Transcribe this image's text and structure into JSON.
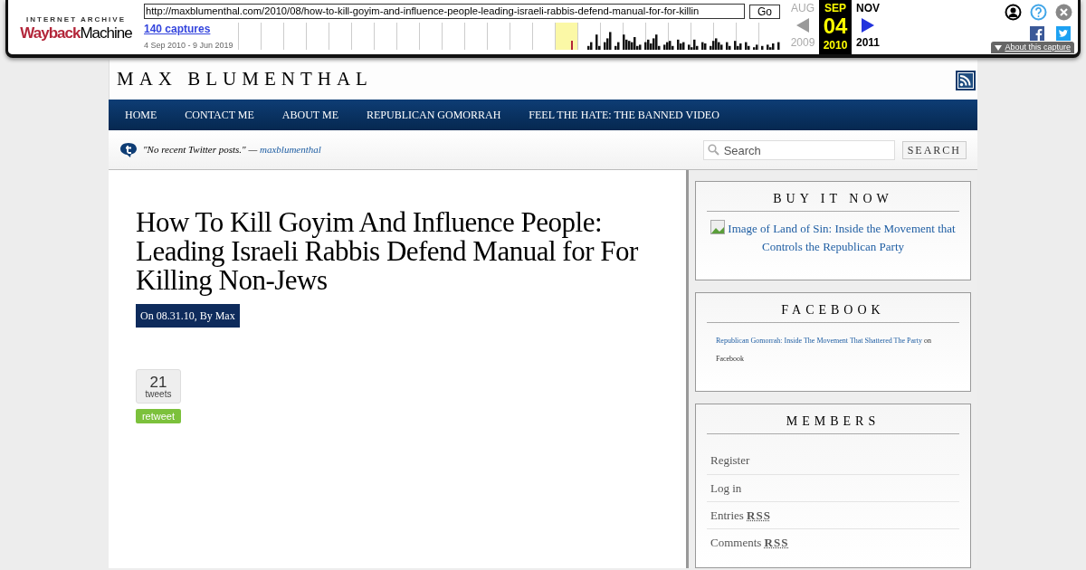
{
  "wayback": {
    "logo_top": "INTERNET ARCHIVE",
    "logo_left": "Wayback",
    "logo_right": "Machine",
    "url": "http://maxblumenthal.com/2010/08/how-to-kill-goyim-and-influence-people-leading-israeli-rabbis-defend-manual-for-for-killin",
    "go": "Go",
    "captures": "140 captures",
    "range": "4 Sep 2010 - 9 Jun 2019",
    "months": [
      {
        "month": "AUG",
        "year": "2009",
        "selected": false
      },
      {
        "month": "SEP",
        "day": "04",
        "year": "2010",
        "selected": true
      },
      {
        "month": "NOV",
        "year": "2011",
        "selected": false
      }
    ],
    "about": "About this capture"
  },
  "site": {
    "title": "MAX BLUMENTHAL",
    "nav": [
      "HOME",
      "CONTACT ME",
      "ABOUT ME",
      "REPUBLICAN GOMORRAH",
      "FEEL THE HATE: THE BANNED VIDEO"
    ],
    "tweet": "\"No recent Twitter posts.\" — ",
    "tweet_user": "maxblumenthal",
    "search": {
      "placeholder": "Search",
      "button": "SEARCH"
    }
  },
  "post": {
    "title": "How To Kill Goyim And Influence People: Leading Israeli Rabbis Defend Manual for For Killing Non-Jews",
    "meta": "On 08.31.10, By Max",
    "tweet_count": "21",
    "tweet_label": "tweets",
    "retweet": "retweet"
  },
  "sidebar": [
    {
      "kind": "image",
      "title": "BUY IT NOW",
      "text": "Image of Land of Sin: Inside the Movement that Controls the Republican Party"
    },
    {
      "kind": "facebook",
      "title": "FACEBOOK",
      "link": "Republican Gomorrah: Inside The Movement That Shattered The Party",
      "text": " on Facebook"
    },
    {
      "kind": "list",
      "title": "MEMBERS",
      "items": [
        "Register",
        "Log in",
        "Entries **RSS**",
        "Comments **RSS**"
      ]
    }
  ]
}
